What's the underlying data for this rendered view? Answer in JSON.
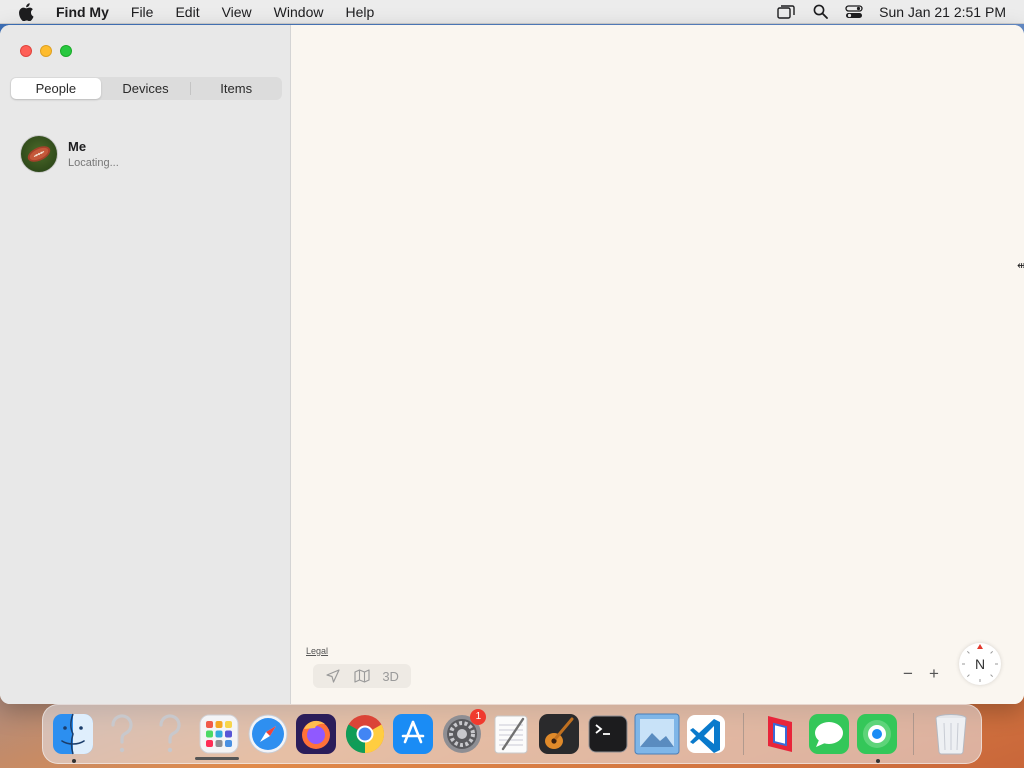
{
  "menubar": {
    "app_name": "Find My",
    "items": [
      "File",
      "Edit",
      "View",
      "Window",
      "Help"
    ],
    "clock": "Sun Jan 21  2:51 PM",
    "icons": [
      "apple-icon",
      "window-switcher-icon",
      "spotlight-search-icon",
      "control-center-icon"
    ]
  },
  "sidebar": {
    "tabs": [
      {
        "label": "People",
        "active": true
      },
      {
        "label": "Devices",
        "active": false
      },
      {
        "label": "Items",
        "active": false
      }
    ],
    "people": [
      {
        "name": "Me",
        "status": "Locating..."
      }
    ]
  },
  "map": {
    "legal": "Legal",
    "controls": {
      "location_icon": "location-arrow-icon",
      "map_icon": "map-icon",
      "three_d": "3D"
    },
    "zoom_out": "−",
    "zoom_in": "+",
    "compass_letter": "N"
  },
  "dock": {
    "apps": [
      {
        "name": "Finder",
        "running": true
      },
      {
        "name": "Unknown App",
        "running": false
      },
      {
        "name": "Unknown App",
        "running": false
      },
      {
        "name": "Launchpad",
        "running": false
      },
      {
        "name": "Safari",
        "running": false
      },
      {
        "name": "Firefox",
        "running": false
      },
      {
        "name": "Chrome",
        "running": false
      },
      {
        "name": "App Store",
        "running": false
      },
      {
        "name": "System Settings",
        "running": false,
        "badge": "1"
      },
      {
        "name": "TextEdit",
        "running": false
      },
      {
        "name": "GarageBand",
        "running": false
      },
      {
        "name": "Terminal",
        "running": false
      },
      {
        "name": "Preview",
        "running": false
      },
      {
        "name": "Visual Studio Code",
        "running": false
      },
      {
        "name": "Parallels",
        "running": false
      },
      {
        "name": "Messages",
        "running": false
      },
      {
        "name": "Find My",
        "running": true
      },
      {
        "name": "Trash",
        "running": false
      }
    ]
  },
  "colors": {
    "close": "#fe5f57",
    "minimize": "#febc2e",
    "maximize": "#28c840",
    "badge": "#f03a2e"
  }
}
